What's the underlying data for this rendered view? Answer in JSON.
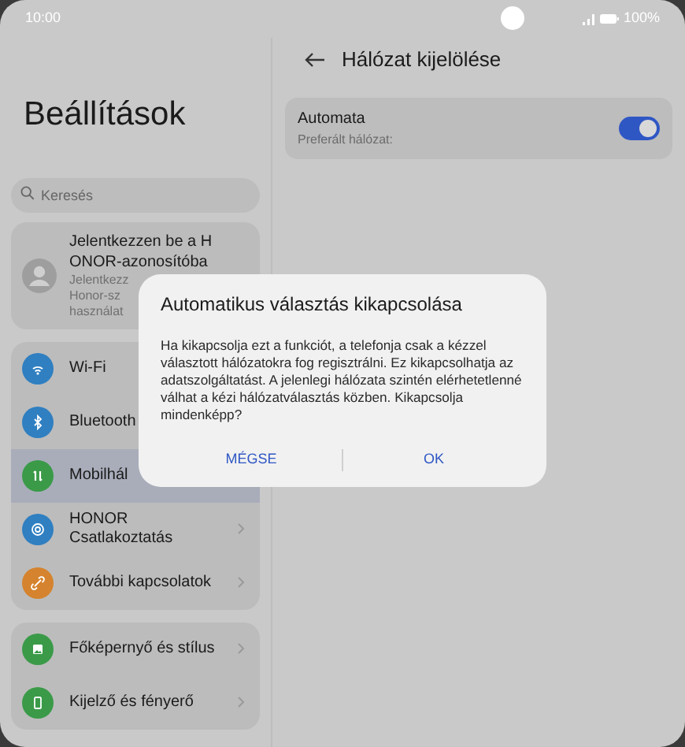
{
  "status_bar": {
    "time": "10:00",
    "battery": "100%"
  },
  "settings": {
    "title": "Beállítások",
    "search": {
      "placeholder": "Keresés"
    },
    "account": {
      "title": "Jelentkezzen be a H ONOR-azonosítóba",
      "subtitle_lines": [
        "Jelentkezz",
        "Honor-sz",
        "használat"
      ]
    },
    "groups": [
      {
        "items": [
          {
            "label": "Wi-Fi",
            "kind": "wifi",
            "color": "#2f7fc1",
            "selected": false,
            "chevron": false
          },
          {
            "label": "Bluetooth",
            "kind": "bluetooth",
            "color": "#2f7fc1",
            "selected": false,
            "chevron": false
          },
          {
            "label": "Mobilhál",
            "kind": "mobile",
            "color": "#3a9a48",
            "selected": true,
            "chevron": false
          },
          {
            "label": "HONOR Csatlakoztatás",
            "kind": "connect",
            "color": "#2f7fc1",
            "selected": false,
            "chevron": true
          },
          {
            "label": "További kapcsolatok",
            "kind": "link",
            "color": "#d5832e",
            "selected": false,
            "chevron": true
          }
        ]
      },
      {
        "items": [
          {
            "label": "Főképernyő és stílus",
            "kind": "image",
            "color": "#3a9a48",
            "selected": false,
            "chevron": true
          },
          {
            "label": "Kijelző és fényerő",
            "kind": "display",
            "color": "#3a9a48",
            "selected": false,
            "chevron": true
          }
        ]
      }
    ]
  },
  "network": {
    "title": "Hálózat kijelölése",
    "automatic": {
      "label": "Automata",
      "sublabel": "Preferált hálózat:",
      "on": true
    }
  },
  "dialog": {
    "title": "Automatikus választás kikapcsolása",
    "message": "Ha kikapcsolja ezt a funkciót, a telefonja csak a kézzel választott hálózatokra fog regisztrálni. Ez kikapcsolhatja az adatszolgáltatást. A jelenlegi hálózata szintén elérhetetlenné válhat a kézi hálózatválasztás közben. Kikapcsolja mindenképp?",
    "buttons": [
      "MÉGSE",
      "OK"
    ]
  }
}
